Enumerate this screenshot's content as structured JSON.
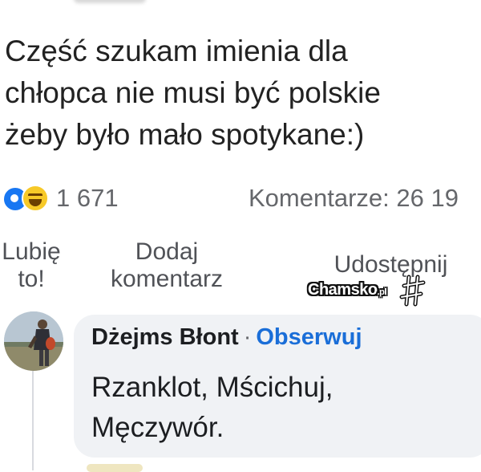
{
  "post": {
    "lines": [
      "Część szukam imienia dla",
      "chłopca nie musi być polskie",
      "żeby było  mało spotykane:)"
    ]
  },
  "stats": {
    "reactions": [
      "like-icon",
      "haha-icon"
    ],
    "reaction_count": "1 671",
    "comments": "Komentarze: 26 19"
  },
  "actions": {
    "like": [
      "Lubię",
      "to!"
    ],
    "comment": [
      "Dodaj",
      "komentarz"
    ],
    "share": "Udostępnij"
  },
  "watermark": {
    "brand": "Chamsko",
    "tld": ".pl"
  },
  "comment": {
    "author": "Dżejms Błont",
    "separator": "·",
    "follow": "Obserwuj",
    "body": [
      "Rzanklot, Mścichuj,",
      "Męczywór."
    ]
  },
  "colors": {
    "link": "#1a6ed8",
    "muted": "#65676b",
    "bubble": "#f0f2f5",
    "like": "#1877f2",
    "haha": "#f7c928"
  }
}
